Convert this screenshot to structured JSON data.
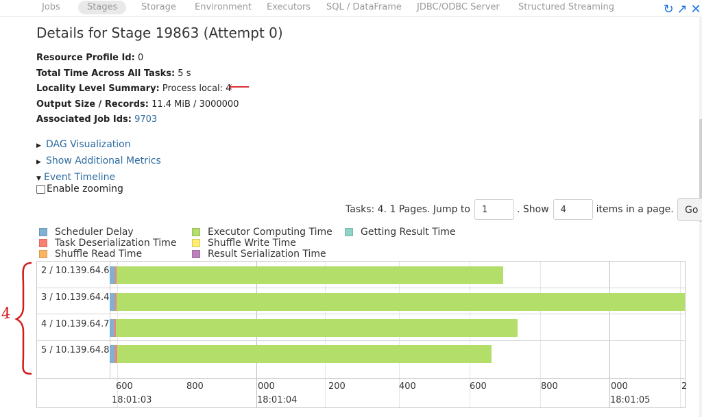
{
  "nav": {
    "tabs": [
      "Jobs",
      "Stages",
      "Storage",
      "Environment",
      "Executors",
      "SQL / DataFrame",
      "JDBC/ODBC Server",
      "Structured Streaming"
    ],
    "active": "Stages",
    "icons": [
      "refresh-icon",
      "open-external-icon",
      "close-icon"
    ]
  },
  "page": {
    "title": "Details for Stage 19863 (Attempt 0)"
  },
  "summary": {
    "resource_label": "Resource Profile Id:",
    "resource_value": "0",
    "total_label": "Total Time Across All Tasks:",
    "total_value": "5 s",
    "locality_label": "Locality Level Summary:",
    "locality_value": "Process local: 4",
    "output_label": "Output Size / Records:",
    "output_value": "11.4 MiB / 3000000",
    "jobs_label": "Associated Job Ids:",
    "jobs_value": "9703"
  },
  "expanders": {
    "dag": "DAG Visualization",
    "metrics": "Show Additional Metrics",
    "timeline": "Event Timeline"
  },
  "zoom_label": "Enable zooming",
  "pager": {
    "prefix": "Tasks: 4. 1 Pages. Jump to",
    "jump_value": "1",
    "show_label": ". Show",
    "show_value": "4",
    "suffix": "items in a page.",
    "go_label": "Go"
  },
  "legend": [
    {
      "label": "Scheduler Delay",
      "color": "#80b1d3"
    },
    {
      "label": "Task Deserialization Time",
      "color": "#fb8072"
    },
    {
      "label": "Shuffle Read Time",
      "color": "#fdb462"
    },
    {
      "label": "Executor Computing Time",
      "color": "#b3de69"
    },
    {
      "label": "Shuffle Write Time",
      "color": "#ffed6f"
    },
    {
      "label": "Result Serialization Time",
      "color": "#bc80bd"
    },
    {
      "label": "Getting Result Time",
      "color": "#8dd3c7"
    }
  ],
  "timeline": {
    "rows": [
      "2 / 10.139.64.6",
      "3 / 10.139.64.4",
      "4 / 10.139.64.7",
      "5 / 10.139.64.8"
    ],
    "minor_ticks": [
      "600",
      "800",
      "000",
      "200",
      "400",
      "600",
      "800",
      "000",
      "2"
    ],
    "major_ticks": [
      "18:01:03",
      "18:01:04",
      "18:01:05"
    ]
  },
  "annotations": {
    "arrow": "⟵",
    "count": "4"
  }
}
